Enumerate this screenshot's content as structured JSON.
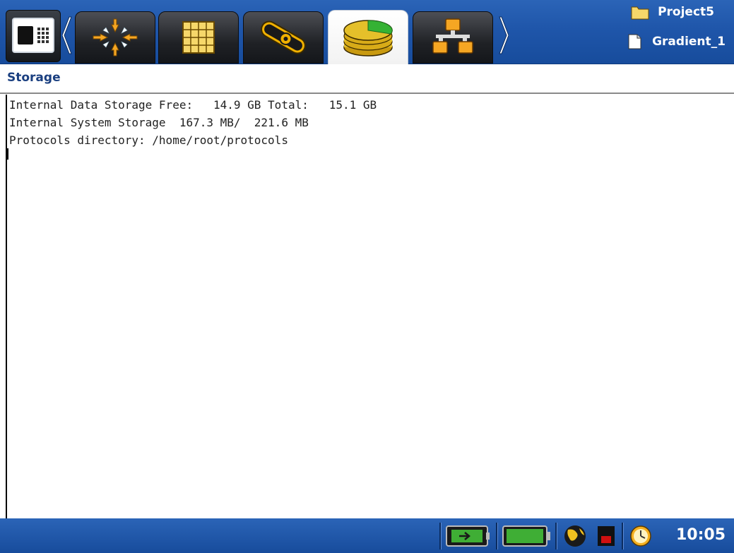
{
  "toolbar": {
    "tabs": [
      {
        "name": "tab-focus",
        "icon": "arrows-converge-icon"
      },
      {
        "name": "tab-grid",
        "icon": "grid-icon"
      },
      {
        "name": "tab-probe",
        "icon": "probe-icon"
      },
      {
        "name": "tab-storage",
        "icon": "storage-disks-icon",
        "active": true
      },
      {
        "name": "tab-network",
        "icon": "network-icon"
      }
    ]
  },
  "project": {
    "folder": "Project5",
    "file": "Gradient_1"
  },
  "page": {
    "title": "Storage"
  },
  "content": {
    "lines": [
      "Internal Data Storage Free:   14.9 GB Total:   15.1 GB",
      "Internal System Storage  167.3 MB/  221.6 MB",
      "Protocols directory: /home/root/protocols"
    ]
  },
  "status": {
    "time": "10:05",
    "icons": [
      "power-plug-icon",
      "battery-icon",
      "globe-icon",
      "red-indicator-icon",
      "clock-icon"
    ]
  },
  "colors": {
    "toolbar_blue": "#1f56aa",
    "title_text": "#1a3f80",
    "storage_green": "#35b234",
    "storage_yellow": "#e5c02a"
  }
}
